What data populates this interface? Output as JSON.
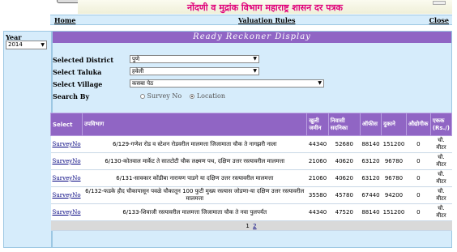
{
  "header": {
    "title": "नोंदणी व मुद्रांक विभाग महाराष्ट्र शासन दर पत्रक"
  },
  "nav": {
    "home": "Home",
    "valuation_rules": "Valuation Rules",
    "close": "Close"
  },
  "sidebar": {
    "year_label": "Year",
    "year_value": "2014"
  },
  "panel": {
    "title": "Ready Reckoner Display"
  },
  "form": {
    "district_label": "Selected District",
    "district_value": "पुणे",
    "taluka_label": "Select Taluka",
    "taluka_value": "हवेली",
    "village_label": "Select Village",
    "village_value": "कसबा पेठ",
    "search_by_label": "Search By",
    "search_by_options": [
      "Survey No",
      "Location"
    ],
    "search_by_selected": "Location"
  },
  "table": {
    "headers": [
      "Select",
      "उपविभाग",
      "खुली जमीन",
      "निवासी सदनिका",
      "ऑफीस",
      "दुकाने",
      "औद्योगीक",
      "एकक (Rs./)"
    ],
    "rows": [
      {
        "select": "SurveyNo",
        "sub": "6/129-गणेश रोड व स्टेशन रोडवरील मालमत्ता जिजामाता चौक ते नागझरी नाला",
        "open": "44340",
        "res": "52680",
        "office": "88140",
        "shop": "151200",
        "ind": "0",
        "unit": "चौ. मीटर"
      },
      {
        "select": "SurveyNo",
        "sub": "6/130-कोतवाल मार्केट ते सातटोटी चौक लक्ष्मण पथ, दक्षिण उत्तर रस्त्यावरील मालमत्ता",
        "open": "21060",
        "res": "40620",
        "office": "63120",
        "shop": "96780",
        "ind": "0",
        "unit": "चौ. मीटर"
      },
      {
        "select": "SurveyNo",
        "sub": "6/131-सावकार कोंडीबा नारायण पाडगे या दक्षिण उत्तर रस्त्यावरील मालमत्ता",
        "open": "21060",
        "res": "40620",
        "office": "63120",
        "shop": "96780",
        "ind": "0",
        "unit": "चौ. मीटर"
      },
      {
        "select": "SurveyNo",
        "sub": "6/132-फडके हौद चौकापासून पवळे चौकातून 100 फुटी मुख्य रस्त्यास जोडणा-या दक्षिण उत्तर रस्त्यावरील मालमत्ता",
        "open": "35580",
        "res": "45780",
        "office": "67440",
        "shop": "94200",
        "ind": "0",
        "unit": "चौ. मीटर"
      },
      {
        "select": "SurveyNo",
        "sub": "6/133-शिवाजी रस्त्यावरील मालमत्ता जिजामाता चौक ते नवा पुलपर्यंत",
        "open": "44340",
        "res": "47520",
        "office": "88140",
        "shop": "151200",
        "ind": "0",
        "unit": "चौ. मीटर"
      }
    ],
    "pages": [
      "1",
      "2"
    ]
  },
  "colors": {
    "panel_bg": "#d6ecfb",
    "header_purple": "#9065c4",
    "title_magenta": "#e0007a"
  }
}
